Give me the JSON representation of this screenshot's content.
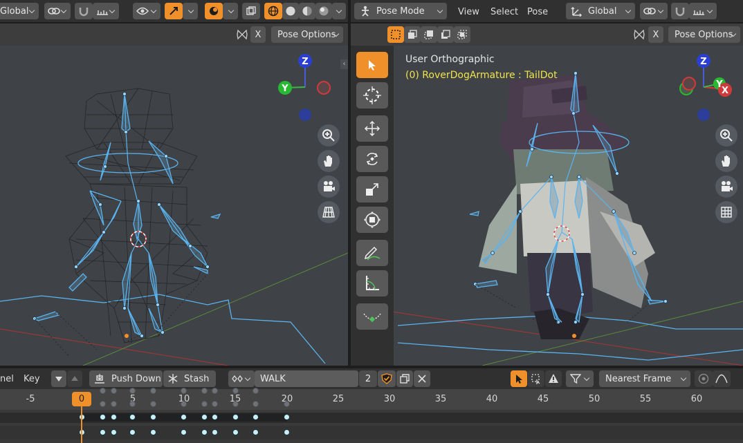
{
  "left_header": {
    "transform_orientation": "Global",
    "pose_options": "Pose Options",
    "x_toggle": "X"
  },
  "right_header": {
    "mode": "Pose Mode",
    "menu": [
      "View",
      "Select",
      "Pose"
    ],
    "transform_orientation": "Global",
    "pose_options": "Pose Options",
    "x_toggle": "X"
  },
  "viewport_right": {
    "view_name": "User Orthographic",
    "object_info": "(0) RoverDogArmature : TailDot"
  },
  "gizmo": {
    "z": "Z",
    "y": "Y",
    "x": "X"
  },
  "timeline": {
    "channel_menu": "nel",
    "key_menu": "Key",
    "push_down": "Push Down",
    "stash": "Stash",
    "action_name": "WALK",
    "user_count": "2",
    "snap_mode": "Nearest Frame",
    "current_frame": "0",
    "frames": [
      "-5",
      "5",
      "10",
      "15",
      "20",
      "25",
      "30",
      "35",
      "40",
      "45",
      "50",
      "55",
      "60"
    ]
  },
  "colors": {
    "accent": "#f0902a",
    "bone": "#5ab4f0",
    "x_axis": "#d13a3a",
    "y_axis": "#28b832",
    "z_axis": "#2b3fd6",
    "object_info": "#f0e44a"
  }
}
